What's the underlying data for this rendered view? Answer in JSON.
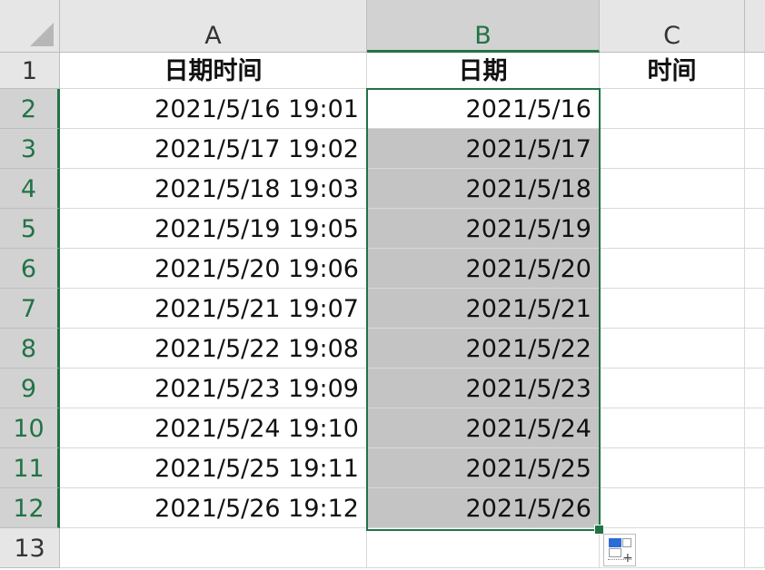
{
  "columns": [
    {
      "id": "A",
      "label": "A"
    },
    {
      "id": "B",
      "label": "B"
    },
    {
      "id": "C",
      "label": "C"
    }
  ],
  "header_row": {
    "number": "1",
    "cells": [
      "日期时间",
      "日期",
      "时间"
    ]
  },
  "rows": [
    {
      "number": "2",
      "datetime": "2021/5/16 19:01",
      "date": "2021/5/16",
      "time": ""
    },
    {
      "number": "3",
      "datetime": "2021/5/17 19:02",
      "date": "2021/5/17",
      "time": ""
    },
    {
      "number": "4",
      "datetime": "2021/5/18 19:03",
      "date": "2021/5/18",
      "time": ""
    },
    {
      "number": "5",
      "datetime": "2021/5/19 19:05",
      "date": "2021/5/19",
      "time": ""
    },
    {
      "number": "6",
      "datetime": "2021/5/20 19:06",
      "date": "2021/5/20",
      "time": ""
    },
    {
      "number": "7",
      "datetime": "2021/5/21 19:07",
      "date": "2021/5/21",
      "time": ""
    },
    {
      "number": "8",
      "datetime": "2021/5/22 19:08",
      "date": "2021/5/22",
      "time": ""
    },
    {
      "number": "9",
      "datetime": "2021/5/23 19:09",
      "date": "2021/5/23",
      "time": ""
    },
    {
      "number": "10",
      "datetime": "2021/5/24 19:10",
      "date": "2021/5/24",
      "time": ""
    },
    {
      "number": "11",
      "datetime": "2021/5/25 19:11",
      "date": "2021/5/25",
      "time": ""
    },
    {
      "number": "12",
      "datetime": "2021/5/26 19:12",
      "date": "2021/5/26",
      "time": ""
    },
    {
      "number": "13",
      "datetime": "",
      "date": "",
      "time": ""
    }
  ],
  "selection": {
    "range": "B2:B12",
    "accent_color": "#217346",
    "flash_fill_shade": "#c4c4c4"
  },
  "icons": {
    "corner": "select-all-triangle",
    "quick_options": "flash-fill-options-icon"
  }
}
